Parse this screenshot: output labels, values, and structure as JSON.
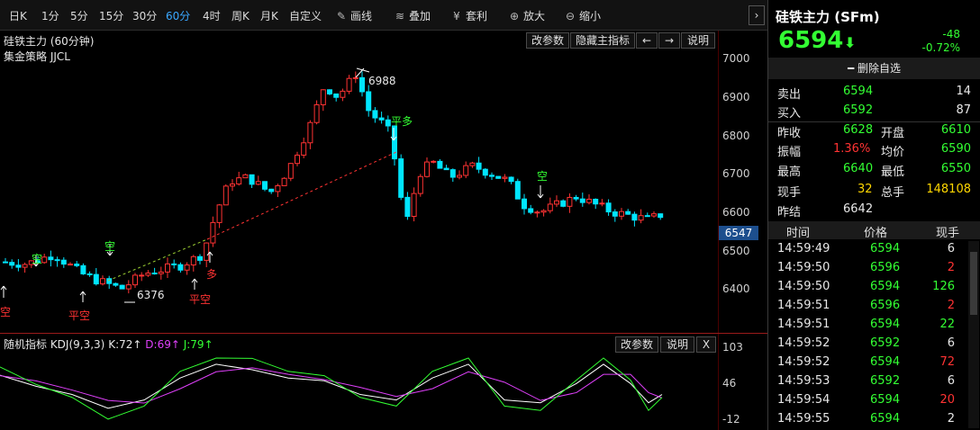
{
  "toolbar": {
    "periods": [
      "日K",
      "1分",
      "5分",
      "15分",
      "30分",
      "60分",
      "4时",
      "周K",
      "月K",
      "自定义"
    ],
    "active_period": "60分",
    "tools": [
      "画线",
      "叠加",
      "套利",
      "放大",
      "缩小"
    ]
  },
  "main_chart": {
    "title": "硅铁主力 (60分钟)",
    "strategy_label": "集金策略 JJCL",
    "buttons": [
      "改参数",
      "隐藏主指标",
      "←",
      "→",
      "说明"
    ],
    "price_axis": [
      "7000",
      "6900",
      "6800",
      "6700",
      "6600",
      "6500",
      "6400"
    ],
    "current_price_tag": "6547",
    "high_label": "6988",
    "low_label": "6376",
    "signals": [
      "平多",
      "空",
      "空",
      "空",
      "空",
      "平空",
      "平空",
      "多"
    ]
  },
  "kdj": {
    "title": "随机指标 KDJ(9,3,3)",
    "k_label": "K:72↑",
    "d_label": "D:69↑",
    "j_label": "J:79↑",
    "buttons": [
      "改参数",
      "说明",
      "X"
    ],
    "axis": [
      "103",
      "46",
      "-12"
    ]
  },
  "panel": {
    "name": "硅铁主力 (SFm)",
    "price": "6594",
    "change": "-48",
    "change_pct": "-0.72%",
    "remove_label": "删除自选",
    "sell_label": "卖出",
    "sell_price": "6594",
    "sell_vol": "14",
    "buy_label": "买入",
    "buy_price": "6592",
    "buy_vol": "87",
    "stats": [
      {
        "l1": "昨收",
        "v1": "6628",
        "l2": "开盘",
        "v2": "6610"
      },
      {
        "l1": "振幅",
        "v1": "1.36%",
        "l2": "均价",
        "v2": "6590"
      },
      {
        "l1": "最高",
        "v1": "6640",
        "l2": "最低",
        "v2": "6550"
      },
      {
        "l1": "现手",
        "v1": "32",
        "l2": "总手",
        "v2": "148108"
      },
      {
        "l1": "昨结",
        "v1": "6642",
        "l2": "",
        "v2": ""
      }
    ],
    "tick_headers": [
      "时间",
      "价格",
      "现手"
    ],
    "ticks": [
      {
        "t": "14:59:49",
        "p": "6594",
        "v": "6"
      },
      {
        "t": "14:59:50",
        "p": "6596",
        "v": "2"
      },
      {
        "t": "14:59:50",
        "p": "6594",
        "v": "126"
      },
      {
        "t": "14:59:51",
        "p": "6596",
        "v": "2"
      },
      {
        "t": "14:59:51",
        "p": "6594",
        "v": "22"
      },
      {
        "t": "14:59:52",
        "p": "6592",
        "v": "6"
      },
      {
        "t": "14:59:52",
        "p": "6594",
        "v": "72"
      },
      {
        "t": "14:59:53",
        "p": "6592",
        "v": "6"
      },
      {
        "t": "14:59:54",
        "p": "6594",
        "v": "20"
      },
      {
        "t": "14:59:55",
        "p": "6594",
        "v": "2"
      }
    ]
  },
  "colors": {
    "up": "#ff3333",
    "down": "#00e5ff",
    "accent": "#3aa8ff",
    "green": "#33ff33"
  }
}
